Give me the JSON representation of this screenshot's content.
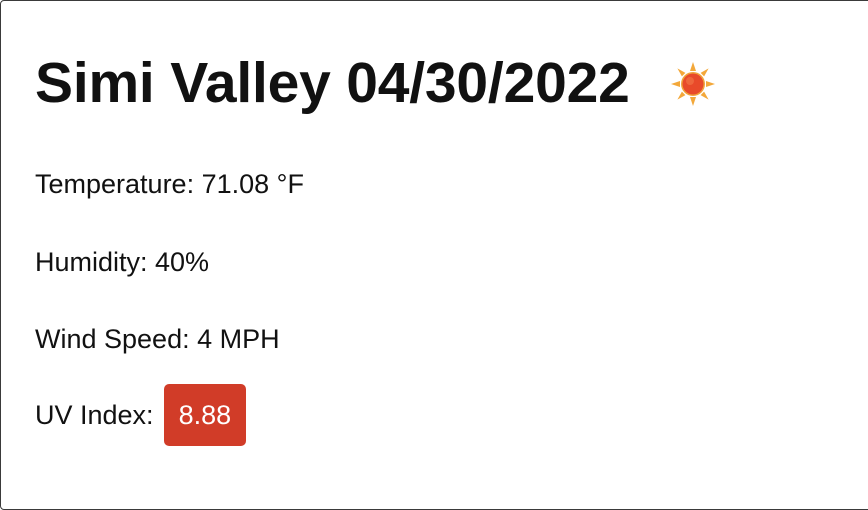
{
  "header": {
    "city": "Simi Valley",
    "date": "04/30/2022",
    "title": "Simi Valley 04/30/2022",
    "weather_icon": "sun-icon"
  },
  "details": {
    "temperature_text": "Temperature: 71.08 °F",
    "humidity_text": "Humidity: 40%",
    "wind_text": "Wind Speed: 4 MPH",
    "uv_label": "UV Index:",
    "uv_value": "8.88"
  },
  "colors": {
    "uv_badge_bg": "#d13c28",
    "uv_badge_text": "#ffffff"
  }
}
